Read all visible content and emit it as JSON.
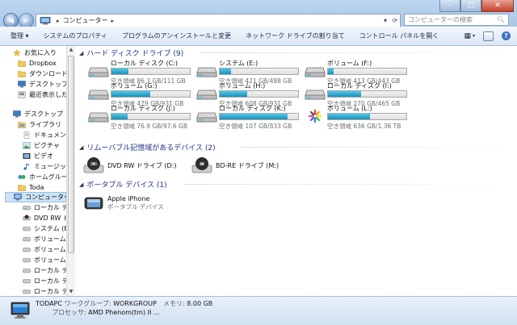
{
  "address": {
    "path_label": "コンピューター",
    "search_placeholder": "コンピューターの検索"
  },
  "toolbar": {
    "organize": "整理 ▾",
    "items": [
      "システムのプロパティ",
      "プログラムのアンインストールと変更",
      "ネットワーク ドライブの割り当て",
      "コントロール パネルを開く"
    ]
  },
  "sidebar": {
    "items": [
      {
        "label": "お気に入り",
        "icon": "star-icon"
      },
      {
        "label": "Dropbox",
        "icon": "folder-icon"
      },
      {
        "label": "ダウンロード",
        "icon": "folder-icon"
      },
      {
        "label": "デスクトップ",
        "icon": "desktop-icon"
      },
      {
        "label": "最近表示した場",
        "icon": "recent-icon"
      },
      {
        "label": "デスクトップ",
        "icon": "desktop-icon"
      },
      {
        "label": "ライブラリ",
        "icon": "library-icon"
      },
      {
        "label": "ドキュメント",
        "icon": "document-icon"
      },
      {
        "label": "ピクチャ",
        "icon": "picture-icon"
      },
      {
        "label": "ビデオ",
        "icon": "video-icon"
      },
      {
        "label": "ミュージック",
        "icon": "music-icon"
      },
      {
        "label": "ホームグループ",
        "icon": "homegroup-icon"
      },
      {
        "label": "Toda",
        "icon": "user-folder-icon"
      },
      {
        "label": "コンピューター",
        "icon": "computer-icon"
      },
      {
        "label": "ローカル ディ",
        "icon": "drive-icon"
      },
      {
        "label": "DVD RW ドラ",
        "icon": "dvd-icon"
      },
      {
        "label": "システム (E:)",
        "icon": "drive-icon"
      },
      {
        "label": "ボリューム (F:",
        "icon": "drive-icon"
      },
      {
        "label": "ボリューム (G",
        "icon": "drive-icon"
      },
      {
        "label": "ボリューム (H",
        "icon": "drive-icon"
      },
      {
        "label": "ローカル ディ",
        "icon": "drive-icon"
      },
      {
        "label": "ローカル ディ",
        "icon": "drive-icon"
      },
      {
        "label": "ローカル ディ",
        "icon": "drive-icon"
      }
    ]
  },
  "groups": {
    "hdd_title": "ハード ディスク ドライブ (9)",
    "removable_title": "リムーバブル記憶域があるデバイス (2)",
    "portable_title": "ポータブル デバイス (1)"
  },
  "drives": [
    {
      "name": "ローカル ディスク (C:)",
      "space": "空き領域 86.3 GB/111 GB",
      "used_fraction": 0.22
    },
    {
      "name": "システム (E:)",
      "space": "空き領域 421 GB/488 GB",
      "used_fraction": 0.14
    },
    {
      "name": "ボリューム (F:)",
      "space": "空き領域 413 GB/443 GB",
      "used_fraction": 0.07
    },
    {
      "name": "ボリューム (G:)",
      "space": "空き領域 479 GB/931 GB",
      "used_fraction": 0.49
    },
    {
      "name": "ボリューム (H:)",
      "space": "空き領域 608 GB/931 GB",
      "used_fraction": 0.35
    },
    {
      "name": "ローカル ディスク (I:)",
      "space": "空き領域 270 GB/465 GB",
      "used_fraction": 0.42
    },
    {
      "name": "ローカル ディスク (J:)",
      "space": "空き領域 76.9 GB/97.6 GB",
      "used_fraction": 0.21
    },
    {
      "name": "ローカル ディスク (K:)",
      "space": "空き領域 107 GB/833 GB",
      "used_fraction": 0.87
    },
    {
      "name": "ボリューム (L:)",
      "space": "空き領域 636 GB/1.36 TB",
      "used_fraction": 0.54
    }
  ],
  "removable": [
    {
      "name": "DVD RW ドライブ (D:)",
      "icon": "dvd-drive-icon"
    },
    {
      "name": "BD-RE ドライブ (M:)",
      "icon": "bd-drive-icon"
    }
  ],
  "portable": {
    "name": "Apple iPhone",
    "sub": "ポータブル デバイス"
  },
  "details": {
    "pc_name": "TODAPC",
    "workgroup_label": "ワークグループ:",
    "workgroup": "WORKGROUP",
    "memory_label": "メモリ:",
    "memory": "8.00 GB",
    "processor_label": "プロセッサ:",
    "processor": "AMD Phenom(tm) II ..."
  }
}
